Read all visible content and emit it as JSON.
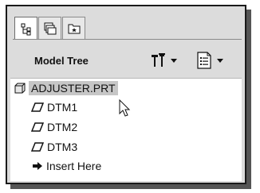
{
  "tabs": [
    {
      "name": "model-tree-tab",
      "icon": "tree-hierarchy-icon",
      "active": true
    },
    {
      "name": "folder-browser-tab",
      "icon": "folder-stack-icon",
      "active": false
    },
    {
      "name": "favorites-tab",
      "icon": "folder-star-icon",
      "active": false
    }
  ],
  "header": {
    "title": "Model Tree",
    "tools": [
      {
        "name": "settings-dropdown",
        "icon": "tools-icon"
      },
      {
        "name": "show-dropdown",
        "icon": "list-view-icon"
      }
    ]
  },
  "tree": {
    "root": {
      "label": "ADJUSTER.PRT",
      "icon": "part-cube-icon"
    },
    "items": [
      {
        "label": "DTM1",
        "icon": "datum-plane-icon"
      },
      {
        "label": "DTM2",
        "icon": "datum-plane-icon"
      },
      {
        "label": "DTM3",
        "icon": "datum-plane-icon"
      },
      {
        "label": "Insert Here",
        "icon": "arrow-right-icon"
      }
    ]
  },
  "colors": {
    "panel_bg": "#dcdcdc",
    "tree_bg": "#ffffff",
    "selection_bg": "#c6c6c6"
  }
}
